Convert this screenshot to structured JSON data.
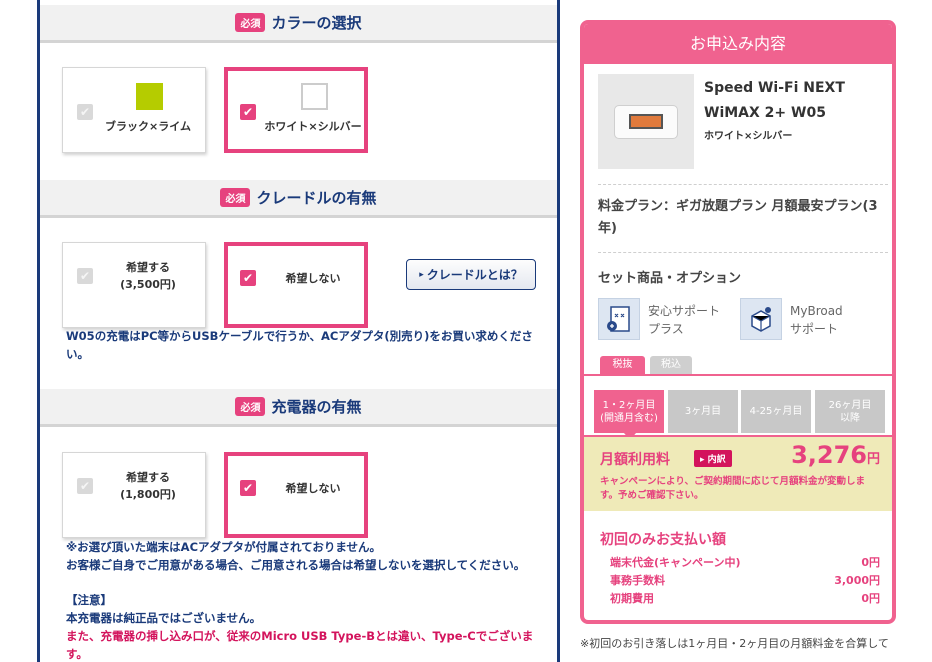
{
  "required_badge": "必須",
  "color_section": {
    "title": "カラーの選択",
    "options": [
      {
        "label": "ブラック×ライム",
        "swatch": "#b5cc00",
        "selected": false
      },
      {
        "label": "ホワイト×シルバー",
        "swatch": "#ffffff",
        "selected": true
      }
    ]
  },
  "cradle_section": {
    "title": "クレードルの有無",
    "options": [
      {
        "label_line1": "希望する",
        "label_line2": "(3,500円)",
        "selected": false
      },
      {
        "label": "希望しない",
        "selected": true
      }
    ],
    "info_button": "クレードルとは？",
    "note": "W05の充電はPC等からUSBケーブルで行うか、ACアダプタ(別売り)をお買い求めください。"
  },
  "charger_section": {
    "title": "充電器の有無",
    "options": [
      {
        "label_line1": "希望する",
        "label_line2": "(1,800円)",
        "selected": false
      },
      {
        "label": "希望しない",
        "selected": true
      }
    ],
    "note1": "※お選び頂いた端末はACアダプタが付属されておりません。",
    "note2": "お客様ご自身でご用意がある場合、ご用意される場合は希望しないを選択してください。",
    "note3": "【注意】",
    "note4": "本充電器は純正品ではございません。",
    "note5": "また、充電器の挿し込み口が、従来のMicro USB Type-Bとは違い、Type-Cでございます。"
  },
  "order_panel": {
    "title": "お申込み内容",
    "product_name": "Speed Wi-Fi NEXT WiMAX 2+ W05",
    "product_color": "ホワイト×シルバー",
    "plan": "料金プラン：ギガ放題プラン 月額最安プラン(3年)",
    "options_title": "セット商品・オプション",
    "option1": "安心サポートプラス",
    "option1_l1": "安心サポート",
    "option1_l2": "プラス",
    "option2_l1": "MyBroad",
    "option2_l2": "サポート",
    "tax_excl": "税抜",
    "tax_incl": "税込",
    "month_tabs": [
      {
        "l1": "1・2ヶ月目",
        "l2": "(開通月含む)"
      },
      {
        "l1": "3ヶ月目",
        "l2": ""
      },
      {
        "l1": "4-25ヶ月目",
        "l2": ""
      },
      {
        "l1": "26ヶ月目",
        "l2": "以降"
      }
    ],
    "monthly_fee_label": "月額利用料",
    "detail_badge": "内訳",
    "monthly_fee_value": "3,276",
    "yen": "円",
    "fee_note": "キャンペーンにより、ご契約期間に応じて月額料金が変動します。予めご確認下さい。",
    "first_payment_title": "初回のみお支払い額",
    "first_rows": [
      {
        "label": "端末代金(キャンペーン中)",
        "value": "0円"
      },
      {
        "label": "事務手数料",
        "value": "3,000円"
      },
      {
        "label": "初期費用",
        "value": "0円"
      }
    ]
  },
  "footer_note": "※初回のお引き落しは1ヶ月目・2ヶ月目の月額料金を合算して"
}
